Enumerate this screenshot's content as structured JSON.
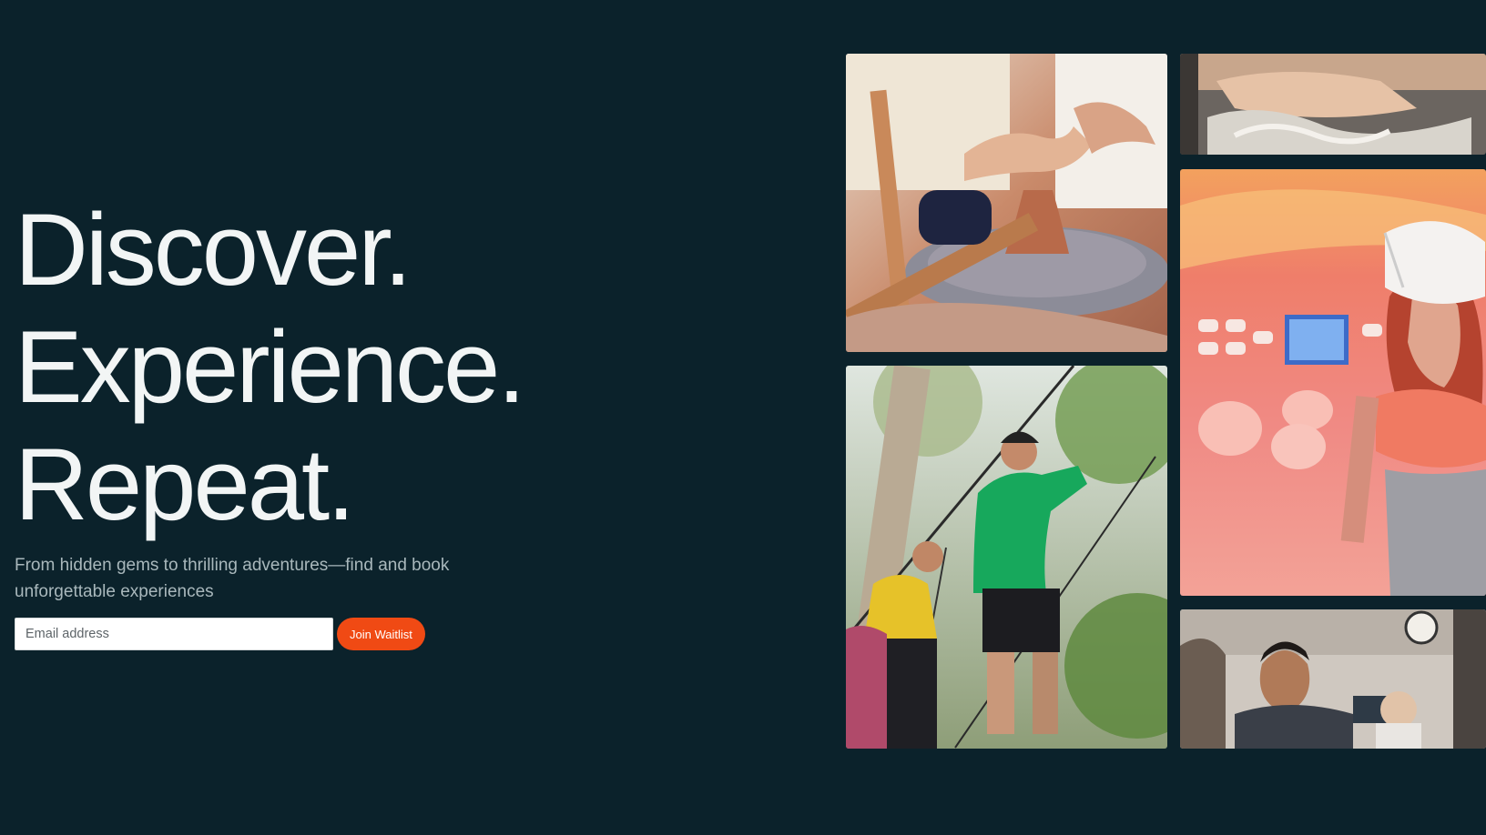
{
  "hero": {
    "headline": [
      "Discover.",
      "Experience.",
      "Repeat."
    ],
    "subtitle": "From hidden gems to thrilling adventures—find and book unforgettable experiences"
  },
  "waitlist": {
    "email_placeholder": "Email address",
    "button_label": "Join Waitlist"
  },
  "colors": {
    "background": "#0b222b",
    "headline": "#f2f5f5",
    "subtitle": "#a9b8bc",
    "accent": "#f04a14"
  },
  "gallery": [
    {
      "name": "pottery-wheel-photo"
    },
    {
      "name": "rope-course-photo"
    },
    {
      "name": "dough-kneading-photo"
    },
    {
      "name": "vr-headset-photo"
    },
    {
      "name": "cooking-class-photo"
    }
  ]
}
